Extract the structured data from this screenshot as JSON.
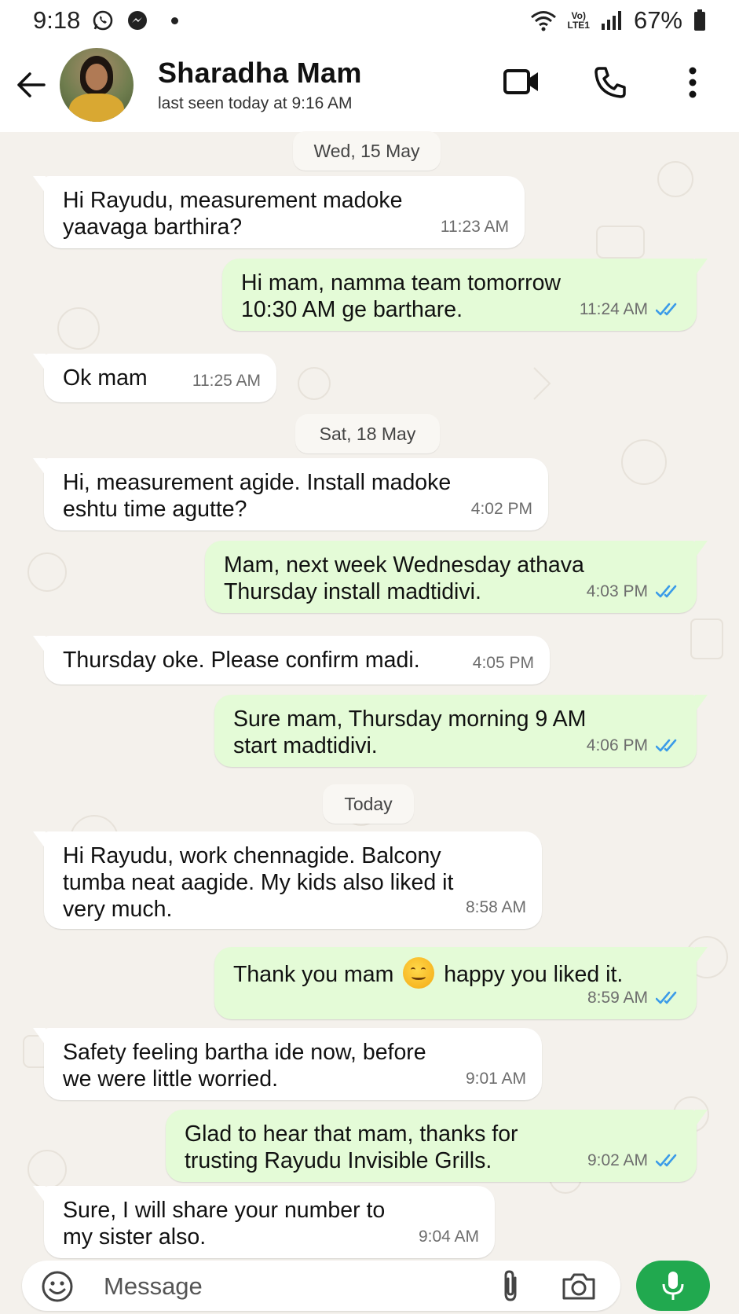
{
  "status_bar": {
    "time": "9:18",
    "volte_top": "Vo)",
    "volte_bottom": "LTE1",
    "battery": "67%"
  },
  "header": {
    "contact_name": "Sharadha Mam",
    "last_seen": "last seen today at 9:16 AM"
  },
  "chat": {
    "date_chips": [
      "Wed, 15 May",
      "Sat, 18 May",
      "Today"
    ],
    "messages": [
      {
        "dir": "in",
        "text": "Hi Rayudu, measurement madoke\nyaavaga barthira?",
        "time": "11:23 AM"
      },
      {
        "dir": "out",
        "text": "Hi mam, namma team tomorrow\n10:30 AM ge barthare.",
        "time": "11:24 AM"
      },
      {
        "dir": "in",
        "text": "Ok mam",
        "time": "11:25 AM"
      },
      {
        "dir": "in",
        "text": "Hi, measurement agide. Install madoke\neshtu time agutte?",
        "time": "4:02 PM"
      },
      {
        "dir": "out",
        "text": "Mam, next week Wednesday athava\nThursday install madtidivi.",
        "time": "4:03 PM"
      },
      {
        "dir": "in",
        "text": "Thursday oke. Please confirm madi.",
        "time": "4:05 PM"
      },
      {
        "dir": "out",
        "text": "Sure mam, Thursday morning 9 AM\nstart madtidivi.",
        "time": "4:06 PM"
      },
      {
        "dir": "in",
        "text": "Hi Rayudu, work chennagide. Balcony\ntumba neat aagide. My kids also liked it\nvery much.",
        "time": "8:58 AM"
      },
      {
        "dir": "out",
        "text_before": "Thank you mam",
        "text_after": "happy you liked it.",
        "emoji": "smiling-face-emoji",
        "time": "8:59 AM"
      },
      {
        "dir": "in",
        "text": "Safety feeling bartha ide now, before\nwe were little worried.",
        "time": "9:01 AM"
      },
      {
        "dir": "out",
        "text": "Glad to hear that mam, thanks for\ntrusting Rayudu Invisible Grills.",
        "time": "9:02 AM"
      },
      {
        "dir": "in",
        "text": "Sure, I will share your number to\nmy sister also.",
        "time": "9:04 AM"
      }
    ]
  },
  "input": {
    "placeholder": "Message"
  },
  "colors": {
    "incoming_bubble": "#ffffff",
    "outgoing_bubble": "#e4fbd7",
    "read_ticks": "#3b9be8",
    "mic_button": "#21a94f",
    "chat_background": "#f4f1ec"
  },
  "icons": [
    "whatsapp-icon",
    "messenger-icon",
    "wifi-icon",
    "signal-icon",
    "battery-icon",
    "back-arrow-icon",
    "video-call-icon",
    "voice-call-icon",
    "more-options-icon",
    "emoji-icon",
    "attach-icon",
    "camera-icon",
    "mic-icon",
    "double-tick-icon"
  ]
}
